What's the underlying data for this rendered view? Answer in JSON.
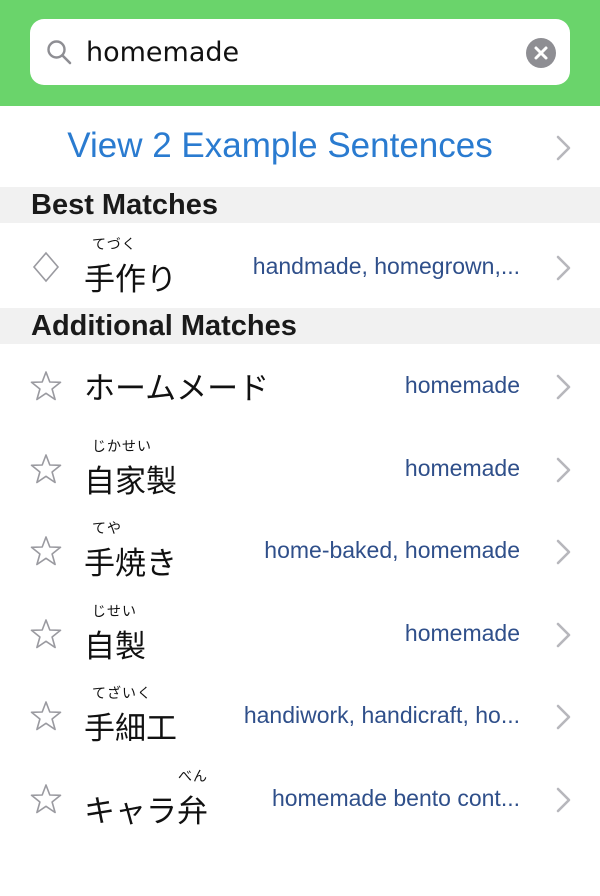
{
  "search": {
    "query": "homemade",
    "icon": "search-icon",
    "clear_icon": "clear-icon"
  },
  "examples": {
    "label": "View 2 Example Sentences"
  },
  "sections": {
    "best": "Best Matches",
    "additional": "Additional Matches"
  },
  "best_matches": [
    {
      "word": "手作り",
      "reading": "てづく",
      "meaning": "handmade, homegrown,...",
      "icon": "diamond-icon"
    }
  ],
  "additional_matches": [
    {
      "word": "ホームメード",
      "reading": "",
      "meaning": "homemade",
      "icon": "star-icon"
    },
    {
      "word": "自家製",
      "reading": "じかせい",
      "meaning": "homemade",
      "icon": "star-icon"
    },
    {
      "word": "手焼き",
      "reading": "てや",
      "meaning": "home-baked, homemade",
      "icon": "star-icon"
    },
    {
      "word": "自製",
      "reading": "じせい",
      "meaning": "homemade",
      "icon": "star-icon"
    },
    {
      "word": "手細工",
      "reading": "てざいく",
      "meaning": "handiwork, handicraft, ho...",
      "icon": "star-icon"
    },
    {
      "word": "キャラ弁",
      "reading": "べん",
      "meaning": "homemade bento cont...",
      "icon": "star-icon"
    }
  ],
  "colors": {
    "header_green": "#6ad46b",
    "link_blue": "#2a7bd0",
    "meaning_blue": "#2f4f8a",
    "section_gray": "#f1f1f1"
  }
}
